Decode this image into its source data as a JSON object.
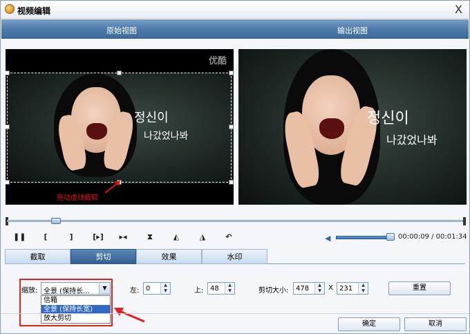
{
  "window": {
    "title": "视频编辑",
    "close_glyph": "X"
  },
  "header": {
    "original_label": "原始视图",
    "output_label": "输出视图"
  },
  "preview": {
    "watermark": "优酷",
    "caption_line1": "정신이",
    "caption_line2": "나갔었나봐",
    "drag_hint": "拖动虚线截取"
  },
  "timeline": {
    "position_fraction": 0.1
  },
  "controls": {
    "pause_glyph": "❚❚",
    "mark_in_glyph": "[",
    "mark_out_glyph": "]",
    "next_frame_glyph": "[▸]",
    "skip_glyph": "▸◂",
    "flip_v_glyph": "⧗",
    "rotate_left_glyph": "◭",
    "rotate_right_glyph": "◮",
    "undo_glyph": "↶",
    "volume_glyph": "◀",
    "volume_fraction": 0.92,
    "time": "00:00:09 / 00:01:34"
  },
  "tabs": [
    {
      "label": "截取",
      "active": false
    },
    {
      "label": "剪切",
      "active": true
    },
    {
      "label": "效果",
      "active": false
    },
    {
      "label": "水印",
      "active": false
    }
  ],
  "crop": {
    "zoom_label": "缩放:",
    "zoom_value": "全景 (保持长...",
    "zoom_options": [
      "信箱",
      "全景 (保持长宽)",
      "放大剪切"
    ],
    "zoom_selected_index": 1,
    "left_label": "左:",
    "left_value": "0",
    "top_label": "上:",
    "top_value": "48",
    "size_label": "剪切大小:",
    "width_value": "478",
    "times": "X",
    "height_value": "231",
    "reset_label": "重置"
  },
  "footer": {
    "ok_label": "确定",
    "cancel_label": "取消"
  },
  "colors": {
    "accent_red": "#e52020",
    "header_blue": "#4b78a8",
    "selection_blue": "#316ac5"
  }
}
